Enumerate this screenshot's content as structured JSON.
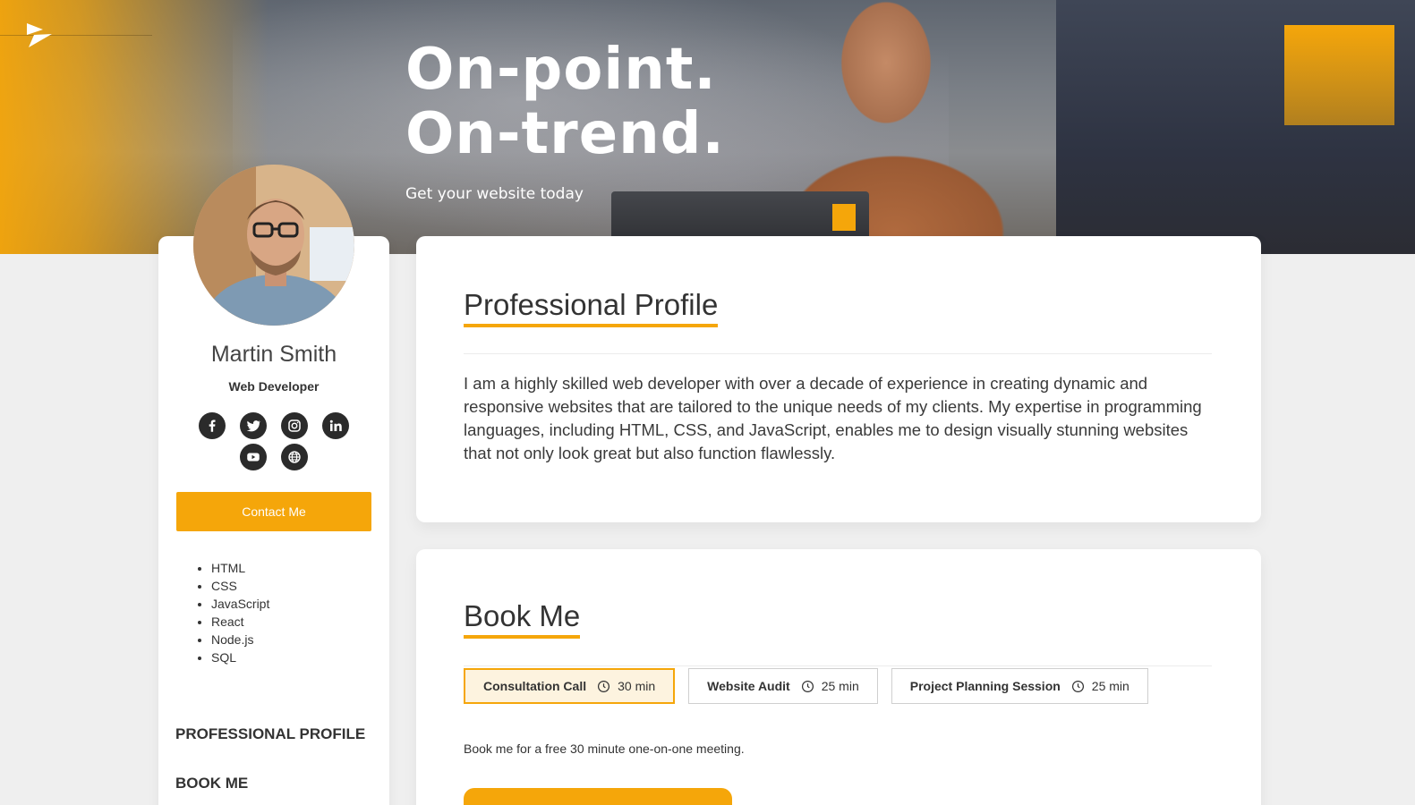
{
  "hero": {
    "title_line1": "On-point.",
    "title_line2": "On-trend.",
    "subtitle": "Get your website today",
    "accent_color": "#f5a60a"
  },
  "logo": {
    "icon": "play-chevron-logo-icon"
  },
  "profile": {
    "name": "Martin Smith",
    "role": "Web Developer",
    "socials": [
      "facebook-icon",
      "twitter-icon",
      "instagram-icon",
      "linkedin-icon",
      "youtube-icon",
      "globe-icon"
    ],
    "contact_label": "Contact Me",
    "skills": [
      "HTML",
      "CSS",
      "JavaScript",
      "React",
      "Node.js",
      "SQL"
    ]
  },
  "side_nav": {
    "professional_profile": "PROFESSIONAL PROFILE",
    "book_me": "BOOK ME"
  },
  "professional_profile": {
    "title": "Professional Profile",
    "text": "I am a highly skilled web developer with over a decade of experience in creating dynamic and responsive websites that are tailored to the unique needs of my clients. My expertise in programming languages, including HTML, CSS, and JavaScript, enables me to design visually stunning websites that not only look great but also function flawlessly."
  },
  "book_me": {
    "title": "Book Me",
    "tabs": [
      {
        "name": "Consultation Call",
        "duration": "30 min",
        "active": true
      },
      {
        "name": "Website Audit",
        "duration": "25 min",
        "active": false
      },
      {
        "name": "Project Planning Session",
        "duration": "25 min",
        "active": false
      }
    ],
    "description": "Book me for a free 30 minute one-on-one meeting."
  }
}
